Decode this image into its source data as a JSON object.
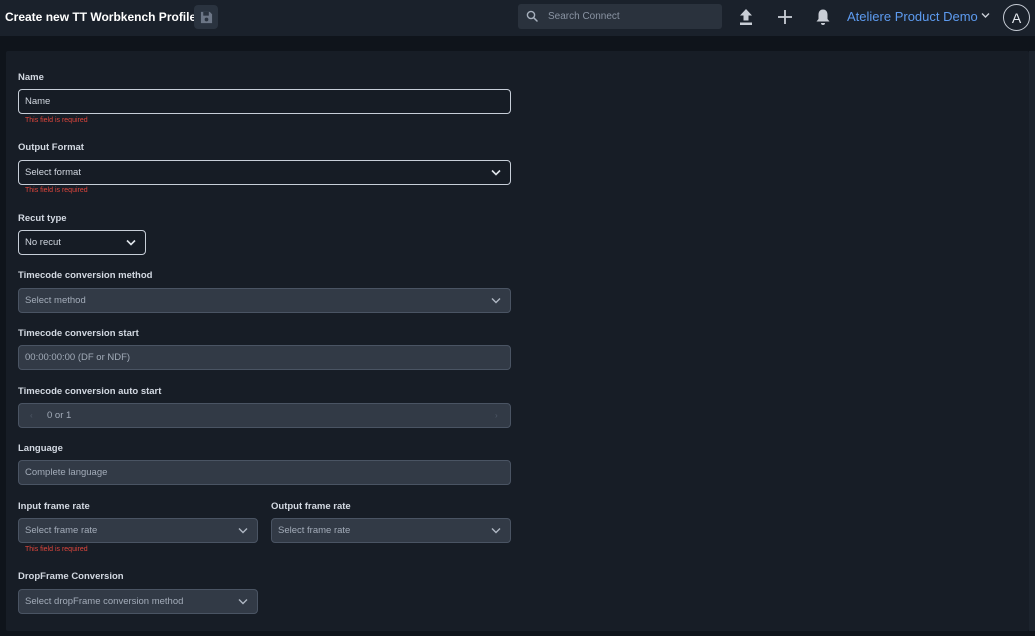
{
  "header": {
    "title": "Create new TT Worbkench Profile",
    "search_placeholder": "Search Connect",
    "account_name": "Ateliere Product Demo",
    "avatar_initial": "A"
  },
  "form": {
    "name": {
      "label": "Name",
      "placeholder": "Name",
      "error": "This field is required"
    },
    "output_format": {
      "label": "Output Format",
      "value": "Select format",
      "error": "This field is required"
    },
    "recut_type": {
      "label": "Recut type",
      "value": "No recut"
    },
    "tc_method": {
      "label": "Timecode conversion method",
      "value": "Select method"
    },
    "tc_start": {
      "label": "Timecode conversion start",
      "placeholder": "00:00:00:00 (DF or NDF)"
    },
    "tc_auto_start": {
      "label": "Timecode conversion auto start",
      "value": "0 or 1"
    },
    "language": {
      "label": "Language",
      "placeholder": "Complete language"
    },
    "input_frame_rate": {
      "label": "Input frame rate",
      "value": "Select frame rate",
      "error": "This field is required"
    },
    "output_frame_rate": {
      "label": "Output frame rate",
      "value": "Select frame rate"
    },
    "dropframe": {
      "label": "DropFrame Conversion",
      "value": "Select dropFrame conversion method"
    }
  },
  "colors": {
    "accent": "#5d9bf0",
    "error": "#e0463c",
    "background": "#0f141b",
    "panel": "#171d26"
  },
  "icons": {
    "save": "floppy-disk-icon",
    "search": "search-icon",
    "upload": "upload-icon",
    "add": "plus-icon",
    "notifications": "bell-icon",
    "dropdown": "chevron-down-icon"
  }
}
